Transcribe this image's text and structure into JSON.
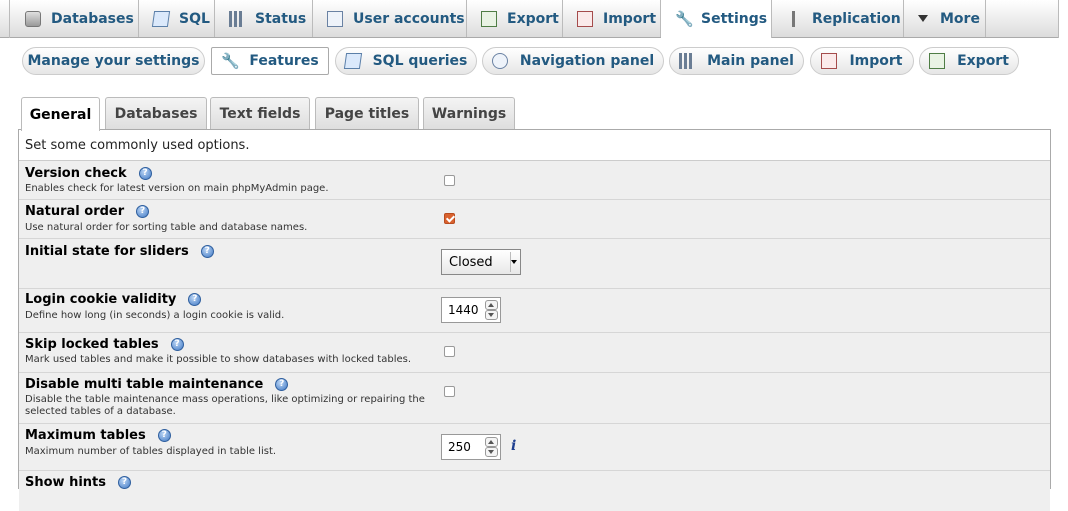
{
  "top_menu": [
    {
      "label": "Databases",
      "icon": "database-icon"
    },
    {
      "label": "SQL",
      "icon": "sql-icon"
    },
    {
      "label": "Status",
      "icon": "status-icon"
    },
    {
      "label": "User accounts",
      "icon": "user-accounts-icon"
    },
    {
      "label": "Export",
      "icon": "export-icon"
    },
    {
      "label": "Import",
      "icon": "import-icon"
    },
    {
      "label": "Settings",
      "icon": "wrench-icon",
      "active": true
    },
    {
      "label": "Replication",
      "icon": "replication-icon"
    },
    {
      "label": "More",
      "icon": "chevron-down-icon"
    }
  ],
  "sub_menu": [
    {
      "label": "Manage your settings",
      "icon": ""
    },
    {
      "label": "Features",
      "icon": "wrench-icon",
      "active": true
    },
    {
      "label": "SQL queries",
      "icon": "sql-icon"
    },
    {
      "label": "Navigation panel",
      "icon": "navigation-icon"
    },
    {
      "label": "Main panel",
      "icon": "main-panel-icon"
    },
    {
      "label": "Import",
      "icon": "import-icon"
    },
    {
      "label": "Export",
      "icon": "export-icon"
    }
  ],
  "tabs": [
    {
      "label": "General",
      "active": true
    },
    {
      "label": "Databases"
    },
    {
      "label": "Text fields"
    },
    {
      "label": "Page titles"
    },
    {
      "label": "Warnings"
    }
  ],
  "panel": {
    "description": "Set some commonly used options.",
    "settings": [
      {
        "name": "Version check",
        "description": "Enables check for latest version on main phpMyAdmin page.",
        "control": "checkbox",
        "checked": false
      },
      {
        "name": "Natural order",
        "description": "Use natural order for sorting table and database names.",
        "control": "checkbox",
        "checked": true
      },
      {
        "name": "Initial state for sliders",
        "description": "",
        "control": "select",
        "value": "Closed"
      },
      {
        "name": "Login cookie validity",
        "description": "Define how long (in seconds) a login cookie is valid.",
        "control": "number",
        "value": "1440"
      },
      {
        "name": "Skip locked tables",
        "description": "Mark used tables and make it possible to show databases with locked tables.",
        "control": "checkbox",
        "checked": false
      },
      {
        "name": "Disable multi table maintenance",
        "description": "Disable the table maintenance mass operations, like optimizing or repairing the selected tables of a database.",
        "control": "checkbox",
        "checked": false
      },
      {
        "name": "Maximum tables",
        "description": "Maximum number of tables displayed in table list.",
        "control": "number",
        "value": "250",
        "info": "i"
      },
      {
        "name": "Show hints",
        "description": "",
        "control": "checkbox",
        "checked": false
      }
    ]
  },
  "colors": {
    "link": "#235a81",
    "checkbox_on": "#d9622f",
    "row_bg": "#efefef"
  }
}
